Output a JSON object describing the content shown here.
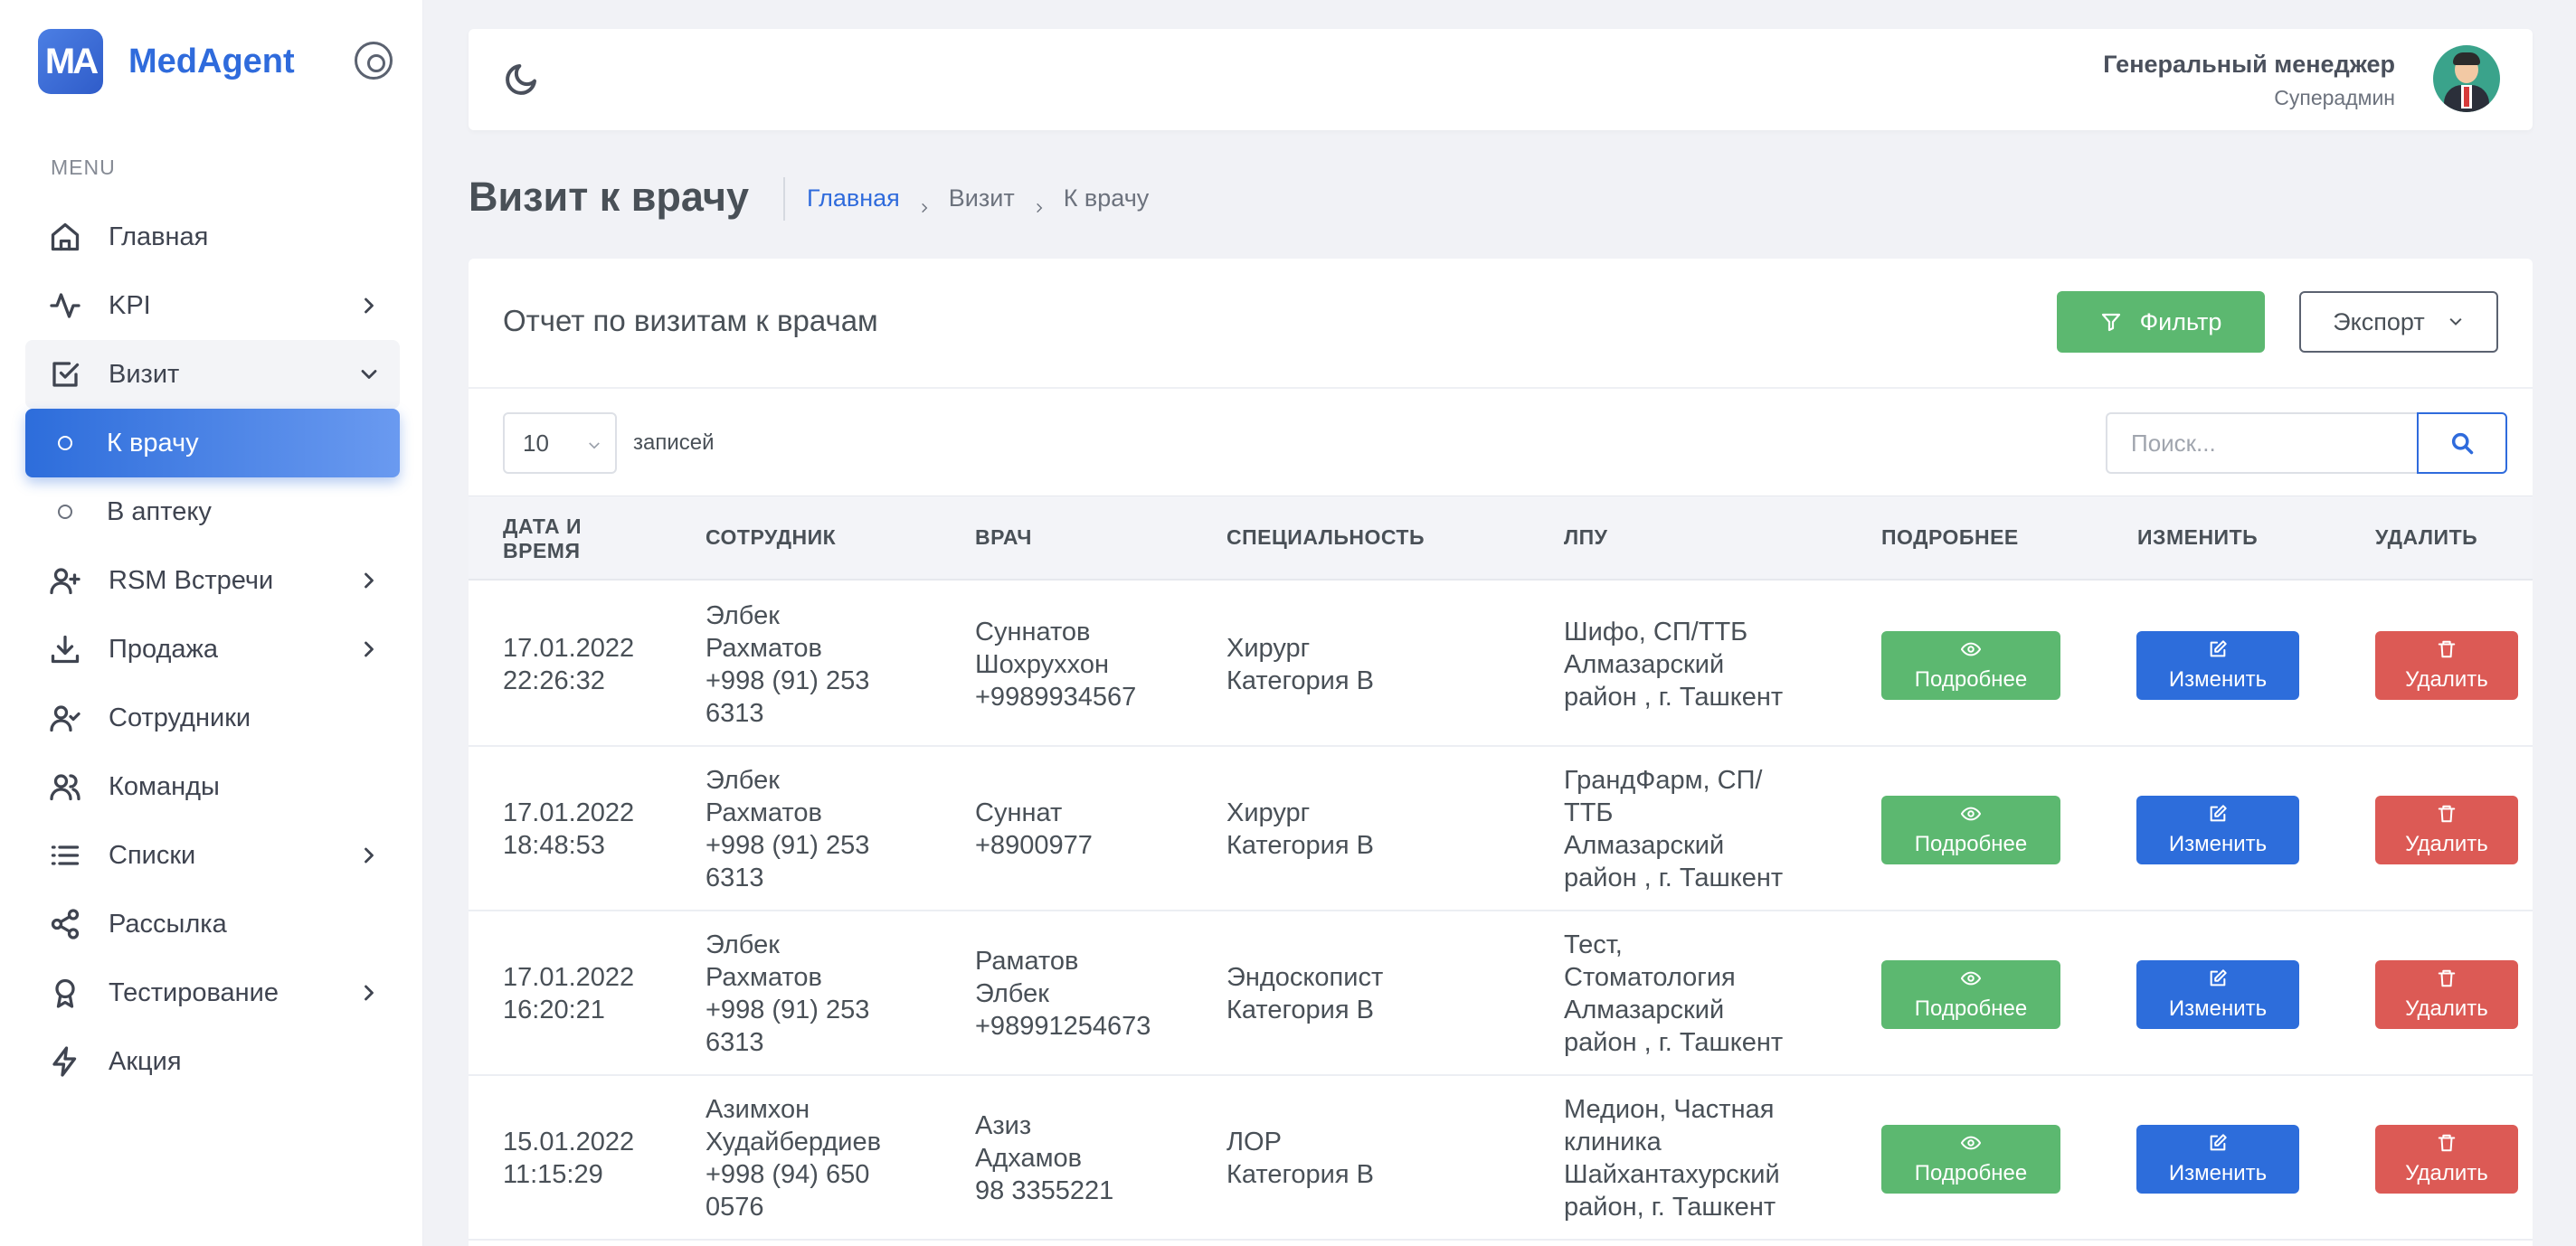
{
  "app": {
    "logo_mark": "MA",
    "name": "MedAgent"
  },
  "sidebar": {
    "caption": "MENU",
    "items": [
      {
        "label": "Главная",
        "icon": "home-icon",
        "has_children": false
      },
      {
        "label": "KPI",
        "icon": "activity-icon",
        "has_children": true
      },
      {
        "label": "Визит",
        "icon": "check-square-icon",
        "has_children": true,
        "open": true,
        "children": [
          {
            "label": "К врачу",
            "active": true
          },
          {
            "label": "В аптеку",
            "active": false
          }
        ]
      },
      {
        "label": "RSM Встречи",
        "icon": "user-plus-icon",
        "has_children": true
      },
      {
        "label": "Продажа",
        "icon": "download-icon",
        "has_children": true
      },
      {
        "label": "Сотрудники",
        "icon": "user-check-icon",
        "has_children": false
      },
      {
        "label": "Команды",
        "icon": "users-icon",
        "has_children": false
      },
      {
        "label": "Списки",
        "icon": "list-icon",
        "has_children": true
      },
      {
        "label": "Рассылка",
        "icon": "share-icon",
        "has_children": false
      },
      {
        "label": "Тестирование",
        "icon": "award-icon",
        "has_children": true
      },
      {
        "label": "Акция",
        "icon": "zap-icon",
        "has_children": false
      }
    ]
  },
  "header": {
    "user_name": "Генеральный менеджер",
    "user_role": "Суперадмин"
  },
  "page": {
    "title": "Визит к врачу",
    "breadcrumb": [
      "Главная",
      "Визит",
      "К врачу"
    ]
  },
  "card": {
    "title": "Отчет по визитам к врачам",
    "filter_label": "Фильтр",
    "export_label": "Экспорт",
    "page_size": "10",
    "page_size_label": "записей",
    "search_placeholder": "Поиск..."
  },
  "table": {
    "columns": [
      "ДАТА И ВРЕМЯ",
      "СОТРУДНИК",
      "ВРАЧ",
      "СПЕЦИАЛЬНОСТЬ",
      "ЛПУ",
      "ПОДРОБНЕЕ",
      "ИЗМЕНИТЬ",
      "УДАЛИТЬ"
    ],
    "column_lines": {
      "date": [
        "ДАТА И",
        "ВРЕМЯ"
      ]
    },
    "action_labels": {
      "view": "Подробнее",
      "edit": "Изменить",
      "delete": "Удалить"
    },
    "rows": [
      {
        "date": [
          "17.01.2022",
          "22:26:32"
        ],
        "employee": [
          "Элбек",
          "Рахматов",
          "+998 (91) 253",
          "6313"
        ],
        "doctor": [
          "Суннатов",
          "Шохруххон",
          "+9989934567"
        ],
        "specialty": [
          "Хирург",
          "Категория B"
        ],
        "lpu": [
          "Шифо, СП/ТТБ",
          "Алмазарский",
          "район , г. Ташкент"
        ]
      },
      {
        "date": [
          "17.01.2022",
          "18:48:53"
        ],
        "employee": [
          "Элбек",
          "Рахматов",
          "+998 (91) 253",
          "6313"
        ],
        "doctor": [
          "Суннат",
          "+8900977"
        ],
        "specialty": [
          "Хирург",
          "Категория B"
        ],
        "lpu": [
          "ГрандФарм, СП/",
          "ТТБ",
          "Алмазарский",
          "район , г. Ташкент"
        ]
      },
      {
        "date": [
          "17.01.2022",
          "16:20:21"
        ],
        "employee": [
          "Элбек",
          "Рахматов",
          "+998 (91) 253",
          "6313"
        ],
        "doctor": [
          "Раматов",
          "Элбек",
          "+98991254673"
        ],
        "specialty": [
          "Эндоскопист",
          "Категория B"
        ],
        "lpu": [
          "Тест,",
          "Стоматология",
          "Алмазарский",
          "район , г. Ташкент"
        ]
      },
      {
        "date": [
          "15.01.2022",
          "11:15:29"
        ],
        "employee": [
          "Азимхон",
          "Худайбердиев",
          "+998 (94) 650",
          "0576"
        ],
        "doctor": [
          "Азиз",
          "Адхамов",
          "98 3355221"
        ],
        "specialty": [
          "ЛОР",
          "Категория B"
        ],
        "lpu": [
          "Медион, Частная",
          "клиника",
          "Шайхантахурский",
          "район, г. Ташкент"
        ]
      }
    ]
  },
  "colors": {
    "primary": "#2d6ddb",
    "success": "#5cb870",
    "danger": "#dc5a55"
  }
}
